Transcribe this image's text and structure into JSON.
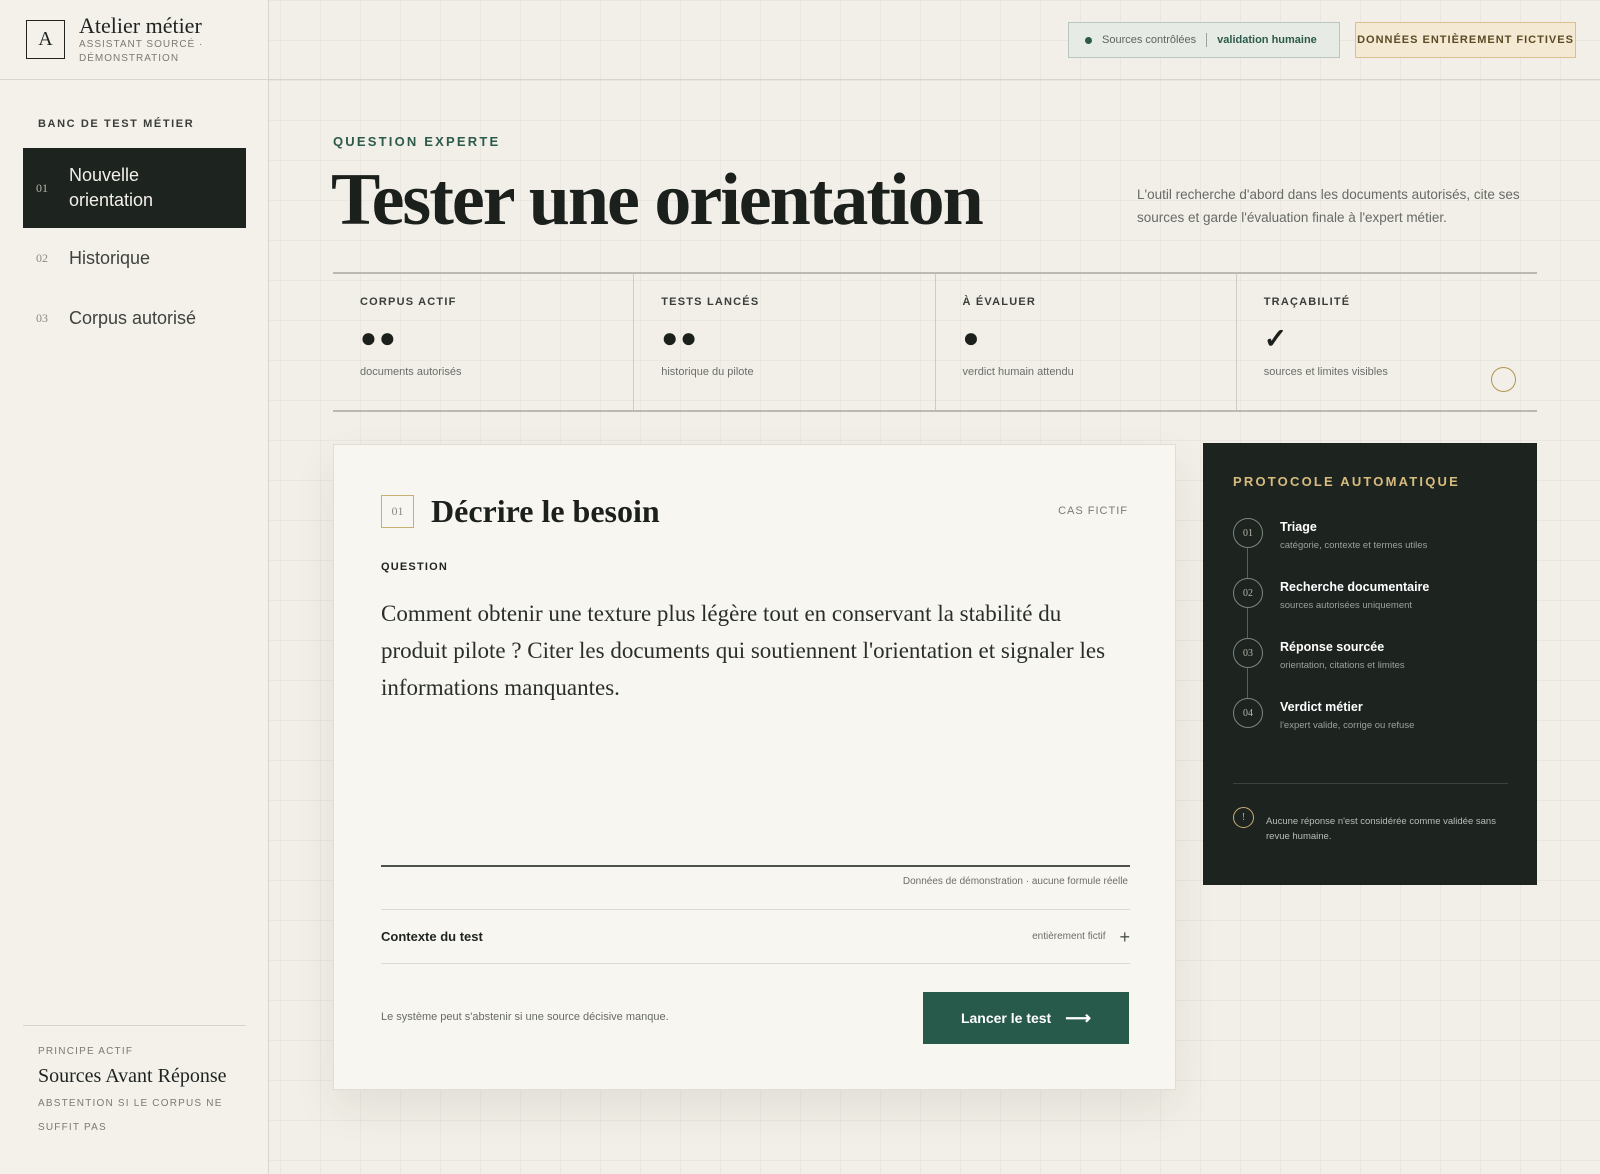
{
  "brand": {
    "mark": "A",
    "name": "Atelier métier",
    "subtitle": "ASSISTANT SOURCÉ · DÉMONSTRATION"
  },
  "sidebar": {
    "section_title": "BANC DE TEST MÉTIER",
    "items": [
      {
        "num": "01",
        "label": "Nouvelle orientation",
        "active": true
      },
      {
        "num": "02",
        "label": "Historique",
        "active": false
      },
      {
        "num": "03",
        "label": "Corpus autorisé",
        "active": false
      }
    ],
    "principle": {
      "kicker": "PRINCIPE ACTIF",
      "title": "Sources Avant Réponse",
      "subtitle": "ABSTENTION SI LE CORPUS NE SUFFIT PAS"
    }
  },
  "topbar": {
    "sources_label": "Sources contrôlées",
    "validation_label": "validation humaine",
    "fictive_badge": "DONNÉES ENTIÈREMENT FICTIVES"
  },
  "header": {
    "kicker": "QUESTION EXPERTE",
    "title": "Tester une orientation",
    "description": "L'outil recherche d'abord dans les documents autorisés, cite ses sources et garde l'évaluation finale à l'expert métier."
  },
  "stats": [
    {
      "label": "CORPUS ACTIF",
      "value": "●●",
      "sub": "documents autorisés"
    },
    {
      "label": "TESTS LANCÉS",
      "value": "●●",
      "sub": "historique du pilote"
    },
    {
      "label": "À ÉVALUER",
      "value": "●",
      "sub": "verdict humain attendu"
    },
    {
      "label": "TRAÇABILITÉ",
      "value": "✓",
      "sub": "sources et limites visibles"
    }
  ],
  "card": {
    "step": "01",
    "title": "Décrire le besoin",
    "case_label": "CAS FICTIF",
    "question_label": "QUESTION",
    "question_text": "Comment obtenir une texture plus légère tout en conservant la stabilité du produit pilote ? Citer les documents qui soutiennent l'orientation et signaler les informations manquantes.",
    "demo_note": "Données de démonstration · aucune formule réelle",
    "context_label": "Contexte du test",
    "context_note": "entièrement fictif",
    "abstention_note": "Le système peut s'abstenir si une source décisive manque.",
    "launch_label": "Lancer le test"
  },
  "protocol": {
    "title": "PROTOCOLE AUTOMATIQUE",
    "steps": [
      {
        "num": "01",
        "name": "Triage",
        "desc": "catégorie, contexte et termes utiles"
      },
      {
        "num": "02",
        "name": "Recherche documentaire",
        "desc": "sources autorisées uniquement"
      },
      {
        "num": "03",
        "name": "Réponse sourcée",
        "desc": "orientation, citations et limites"
      },
      {
        "num": "04",
        "name": "Verdict métier",
        "desc": "l'expert valide, corrige ou refuse"
      }
    ],
    "info_glyph": "!",
    "note": "Aucune réponse n'est considérée comme validée sans revue humaine."
  },
  "icons": {
    "plus": "plus-icon",
    "arrow": "arrow-right-icon",
    "info": "info-icon",
    "ring": "circle-icon"
  },
  "colors": {
    "accent_green": "#285a4c",
    "dark_panel": "#1d2420",
    "gold": "#d7bc7e",
    "background": "#f2efe8"
  }
}
